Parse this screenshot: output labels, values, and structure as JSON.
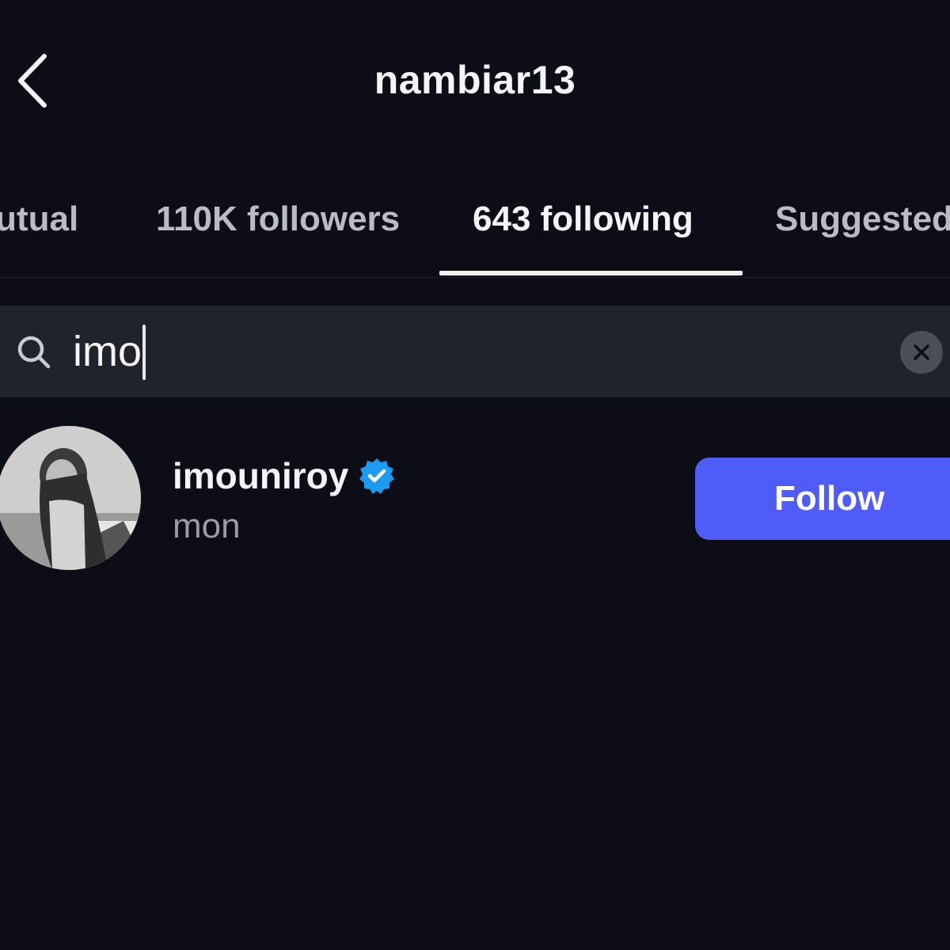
{
  "header": {
    "title": "nambiar13",
    "back_icon": "chevron-left-icon"
  },
  "tabs": [
    {
      "label": "mutual",
      "active": false
    },
    {
      "label": "110K followers",
      "active": false
    },
    {
      "label": "643 following",
      "active": true
    },
    {
      "label": "Suggested",
      "active": false
    }
  ],
  "search": {
    "value": "imo",
    "search_icon": "search-icon",
    "clear_icon": "clear-icon"
  },
  "results": [
    {
      "username": "imouniroy",
      "verified": true,
      "full_name": "mon",
      "action_label": "Follow"
    }
  ],
  "colors": {
    "background": "#0b0e16",
    "search_bg": "#1f232c",
    "follow_button": "#4f5cf6",
    "verified_badge": "#1d9bf0"
  }
}
